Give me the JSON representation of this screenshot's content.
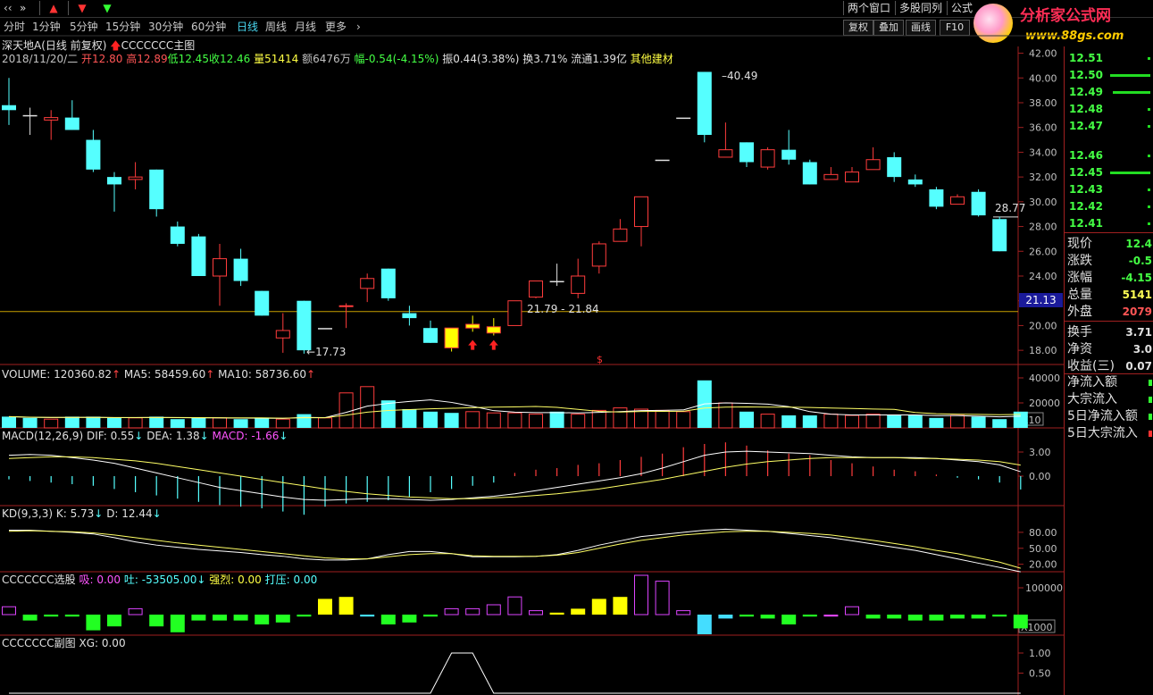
{
  "topbar": {
    "expand_label": "»",
    "windows_label": "两个窗口",
    "multi_label": "多股同列",
    "formula_label": "公式",
    "logo_main": "分析家公式网",
    "logo_url": "www.88gs.com"
  },
  "periods": [
    {
      "label": "分时",
      "active": false
    },
    {
      "label": "1分钟",
      "active": false
    },
    {
      "label": "5分钟",
      "active": false
    },
    {
      "label": "15分钟",
      "active": false
    },
    {
      "label": "30分钟",
      "active": false
    },
    {
      "label": "60分钟",
      "active": false
    },
    {
      "label": "日线",
      "active": true
    },
    {
      "label": "周线",
      "active": false
    },
    {
      "label": "月线",
      "active": false
    },
    {
      "label": "更多",
      "active": false
    }
  ],
  "tools": [
    "复权",
    "叠加",
    "画线",
    "F10"
  ],
  "stock": {
    "name": "深天地A",
    "mode": "(日线 前复权)",
    "indicator": "CCCCCCC主图"
  },
  "quote": {
    "date": "2018/11/20/二",
    "open": "开12.80",
    "high": "高12.89",
    "low": "低12.45",
    "close": "收12.46",
    "volume": "量51414",
    "amount": "额6476万",
    "change": "幅-0.54(-4.15%)",
    "amplitude": "振0.44(3.38%)",
    "turnover": "换3.71%",
    "float": "流通1.39亿",
    "sector": "其他建材"
  },
  "annotations": {
    "high_label": "40.49",
    "low_label": "17.73",
    "range_label": "21.79 - 21.84",
    "last_label": "28.77",
    "cursor_price": "21.13"
  },
  "price_ticks": [
    "42.00",
    "40.00",
    "38.00",
    "36.00",
    "34.00",
    "32.00",
    "30.00",
    "28.00",
    "26.00",
    "24.00",
    "22.00",
    "20.00",
    "18.00"
  ],
  "volume_panel": {
    "title": "VOLUME: 120360.82",
    "ma5": "MA5: 58459.60",
    "ma10": "MA10: 58736.60",
    "ticks": [
      "40000",
      "20000"
    ],
    "unit": "X10"
  },
  "macd_panel": {
    "title": "MACD(12,26,9)",
    "dif": "DIF: 0.55",
    "dea": "DEA: 1.38",
    "macd": "MACD: -1.66",
    "ticks": [
      "3.00",
      "0.00"
    ]
  },
  "kd_panel": {
    "title": "KD(9,3,3)",
    "k": "K: 5.73",
    "d": "D: 12.44",
    "ticks": [
      "80.00",
      "50.00",
      "20.00"
    ]
  },
  "select_panel": {
    "title": "CCCCCCC选股",
    "xi": "吸: 0.00",
    "tu": "吐: -53505.00",
    "qiang": "强烈: 0.00",
    "daya": "打压: 0.00",
    "ticks": [
      "100000"
    ],
    "unit": "X1000"
  },
  "sub_panel": {
    "title": "CCCCCCC副图",
    "xg": "XG: 0.00",
    "ticks": [
      "1.00",
      "0.50"
    ]
  },
  "order_book": [
    {
      "price": "12.51",
      "bar": 0.05
    },
    {
      "price": "12.50",
      "bar": 0.75
    },
    {
      "price": "12.49",
      "bar": 0.7
    },
    {
      "price": "12.48",
      "bar": 0.05
    },
    {
      "price": "12.47",
      "bar": 0.05
    },
    {
      "price": "12.46",
      "bar": 0.05
    },
    {
      "price": "12.45",
      "bar": 0.75
    },
    {
      "price": "12.43",
      "bar": 0.05
    },
    {
      "price": "12.42",
      "bar": 0.05
    },
    {
      "price": "12.41",
      "bar": 0.05
    }
  ],
  "stats": [
    {
      "label": "现价",
      "value": "12.4",
      "color": "#44ff44"
    },
    {
      "label": "涨跌",
      "value": "-0.5",
      "color": "#44ff44"
    },
    {
      "label": "涨幅",
      "value": "-4.15",
      "color": "#44ff44"
    },
    {
      "label": "总量",
      "value": "5141",
      "color": "#ffff55"
    },
    {
      "label": "外盘",
      "value": "2079",
      "color": "#ff5555"
    },
    {
      "label": "换手",
      "value": "3.71",
      "color": "#e0e0e0"
    },
    {
      "label": "净资",
      "value": "3.0",
      "color": "#e0e0e0"
    },
    {
      "label": "收益(三)",
      "value": "0.07",
      "color": "#e0e0e0"
    }
  ],
  "flows": [
    "净流入额",
    "大宗流入",
    "5日净流入额",
    "5日大宗流入"
  ],
  "chart_data": {
    "type": "candlestick",
    "ylim": [
      17,
      42.4
    ],
    "candles": [
      {
        "o": 37.8,
        "h": 40.0,
        "l": 36.2,
        "c": 37.4,
        "dir": "down"
      },
      {
        "o": 37.0,
        "h": 37.6,
        "l": 35.4,
        "c": 36.8,
        "dir": "flat"
      },
      {
        "o": 36.6,
        "h": 37.4,
        "l": 35.0,
        "c": 36.8,
        "dir": "up"
      },
      {
        "o": 36.8,
        "h": 38.2,
        "l": 35.8,
        "c": 35.8,
        "dir": "down"
      },
      {
        "o": 35.0,
        "h": 35.8,
        "l": 32.4,
        "c": 32.6,
        "dir": "down"
      },
      {
        "o": 32.0,
        "h": 32.4,
        "l": 29.2,
        "c": 31.4,
        "dir": "down"
      },
      {
        "o": 31.8,
        "h": 33.2,
        "l": 31.0,
        "c": 32.0,
        "dir": "up"
      },
      {
        "o": 32.6,
        "h": 32.6,
        "l": 28.8,
        "c": 29.4,
        "dir": "down"
      },
      {
        "o": 28.0,
        "h": 28.4,
        "l": 26.4,
        "c": 26.6,
        "dir": "down"
      },
      {
        "o": 27.2,
        "h": 27.4,
        "l": 24.0,
        "c": 24.0,
        "dir": "down"
      },
      {
        "o": 24.0,
        "h": 26.6,
        "l": 21.6,
        "c": 25.4,
        "dir": "up"
      },
      {
        "o": 25.4,
        "h": 26.2,
        "l": 23.2,
        "c": 23.6,
        "dir": "down"
      },
      {
        "o": 22.8,
        "h": 22.8,
        "l": 20.8,
        "c": 20.8,
        "dir": "down"
      },
      {
        "o": 19.0,
        "h": 21.0,
        "l": 17.8,
        "c": 19.6,
        "dir": "up"
      },
      {
        "o": 22.0,
        "h": 22.0,
        "l": 17.73,
        "c": 18.0,
        "dir": "down"
      },
      {
        "o": 19.8,
        "h": 19.8,
        "l": 19.8,
        "c": 19.8,
        "dir": "flat"
      },
      {
        "o": 21.6,
        "h": 21.8,
        "l": 19.8,
        "c": 21.6,
        "dir": "up"
      },
      {
        "o": 23.0,
        "h": 24.2,
        "l": 21.9,
        "c": 23.8,
        "dir": "up"
      },
      {
        "o": 24.6,
        "h": 24.6,
        "l": 22.0,
        "c": 22.2,
        "dir": "down"
      },
      {
        "o": 21.0,
        "h": 21.6,
        "l": 20.0,
        "c": 20.6,
        "dir": "down"
      },
      {
        "o": 19.8,
        "h": 20.4,
        "l": 18.6,
        "c": 18.6,
        "dir": "down"
      },
      {
        "o": 18.2,
        "h": 19.8,
        "l": 17.9,
        "c": 19.8,
        "dir": "yellow"
      },
      {
        "o": 19.8,
        "h": 20.8,
        "l": 19.5,
        "c": 20.1,
        "dir": "yellow"
      },
      {
        "o": 19.4,
        "h": 20.6,
        "l": 19.2,
        "c": 19.9,
        "dir": "yellow"
      },
      {
        "o": 20.0,
        "h": 22.0,
        "l": 20.0,
        "c": 22.0,
        "dir": "up"
      },
      {
        "o": 22.3,
        "h": 23.6,
        "l": 22.2,
        "c": 23.6,
        "dir": "up"
      },
      {
        "o": 23.6,
        "h": 25.0,
        "l": 23.2,
        "c": 23.6,
        "dir": "flat"
      },
      {
        "o": 22.6,
        "h": 25.4,
        "l": 22.2,
        "c": 24.0,
        "dir": "up"
      },
      {
        "o": 24.8,
        "h": 26.8,
        "l": 24.2,
        "c": 26.6,
        "dir": "up"
      },
      {
        "o": 26.8,
        "h": 28.6,
        "l": 26.8,
        "c": 27.8,
        "dir": "up"
      },
      {
        "o": 28.0,
        "h": 30.4,
        "l": 26.4,
        "c": 30.4,
        "dir": "up"
      },
      {
        "o": 33.4,
        "h": 33.4,
        "l": 33.4,
        "c": 33.4,
        "dir": "flat"
      },
      {
        "o": 36.8,
        "h": 36.8,
        "l": 36.8,
        "c": 36.8,
        "dir": "flat"
      },
      {
        "o": 40.49,
        "h": 40.49,
        "l": 34.8,
        "c": 35.4,
        "dir": "down"
      },
      {
        "o": 33.6,
        "h": 36.4,
        "l": 33.6,
        "c": 34.2,
        "dir": "up"
      },
      {
        "o": 34.8,
        "h": 34.8,
        "l": 32.8,
        "c": 33.2,
        "dir": "down"
      },
      {
        "o": 32.8,
        "h": 34.4,
        "l": 32.6,
        "c": 34.2,
        "dir": "up"
      },
      {
        "o": 34.2,
        "h": 35.8,
        "l": 33.0,
        "c": 33.4,
        "dir": "down"
      },
      {
        "o": 33.2,
        "h": 33.4,
        "l": 31.4,
        "c": 31.4,
        "dir": "down"
      },
      {
        "o": 31.8,
        "h": 32.8,
        "l": 31.8,
        "c": 32.2,
        "dir": "up"
      },
      {
        "o": 31.6,
        "h": 32.8,
        "l": 31.6,
        "c": 32.4,
        "dir": "up"
      },
      {
        "o": 32.6,
        "h": 34.4,
        "l": 32.6,
        "c": 33.4,
        "dir": "up"
      },
      {
        "o": 33.6,
        "h": 34.0,
        "l": 31.6,
        "c": 32.0,
        "dir": "down"
      },
      {
        "o": 31.8,
        "h": 32.2,
        "l": 31.2,
        "c": 31.4,
        "dir": "down"
      },
      {
        "o": 31.0,
        "h": 31.2,
        "l": 29.4,
        "c": 29.6,
        "dir": "down"
      },
      {
        "o": 29.8,
        "h": 30.6,
        "l": 29.8,
        "c": 30.4,
        "dir": "up"
      },
      {
        "o": 30.8,
        "h": 31.0,
        "l": 28.8,
        "c": 28.9,
        "dir": "down"
      },
      {
        "o": 28.6,
        "h": 28.8,
        "l": 26.0,
        "c": 26.0,
        "dir": "down"
      }
    ],
    "volume": [
      9,
      8,
      7,
      9,
      9,
      8,
      8,
      9,
      7,
      8,
      8,
      7,
      8,
      7,
      11,
      8,
      28,
      33,
      22,
      15,
      13,
      12,
      13,
      12,
      12,
      11,
      13,
      11,
      14,
      16,
      15,
      14,
      13,
      38,
      20,
      13,
      11,
      10,
      10,
      11,
      10,
      11,
      10,
      10,
      8,
      10,
      9,
      7,
      13
    ],
    "vol_dir": [
      "down",
      "down",
      "up",
      "down",
      "down",
      "down",
      "up",
      "down",
      "down",
      "down",
      "up",
      "down",
      "down",
      "up",
      "down",
      "up",
      "up",
      "up",
      "down",
      "down",
      "down",
      "down",
      "up",
      "up",
      "up",
      "up",
      "down",
      "up",
      "up",
      "up",
      "up",
      "up",
      "up",
      "down",
      "up",
      "down",
      "up",
      "down",
      "down",
      "up",
      "up",
      "up",
      "down",
      "down",
      "down",
      "up",
      "down",
      "down",
      "down"
    ],
    "vol_ma5": [
      9,
      8.5,
      8.3,
      8.4,
      8.5,
      8.2,
      8.2,
      8.4,
      8.2,
      8.0,
      8.0,
      7.9,
      7.8,
      7.6,
      8.4,
      8.2,
      12.4,
      17.4,
      19.6,
      21.2,
      22.4,
      20.4,
      17.2,
      13.8,
      12.6,
      12.2,
      12.2,
      12.0,
      12.4,
      13.0,
      13.8,
      14.0,
      14.4,
      19.2,
      20.0,
      19.6,
      19.0,
      17.0,
      13.0,
      11.0,
      10.4,
      10.4,
      10.4,
      10.4,
      9.8,
      9.8,
      9.4,
      8.8,
      9.4
    ],
    "vol_ma10": [
      9,
      8.6,
      8.4,
      8.4,
      8.4,
      8.3,
      8.3,
      8.3,
      8.3,
      8.2,
      8.1,
      8.0,
      8.0,
      7.8,
      8.1,
      8.1,
      10.2,
      12.6,
      13.9,
      14.6,
      15.3,
      15.7,
      16.2,
      16.6,
      16.8,
      17.1,
      16.4,
      14.8,
      13.2,
      12.7,
      13.1,
      13.2,
      13.3,
      15.9,
      16.6,
      16.8,
      16.6,
      16.6,
      16.3,
      15.9,
      15.5,
      15.1,
      14.8,
      12.3,
      11.3,
      11.0,
      10.8,
      10.5,
      10.8
    ],
    "macd_hist": [
      -0.4,
      -0.6,
      -0.8,
      -1.0,
      -1.2,
      -1.6,
      -2.0,
      -2.4,
      -2.8,
      -3.2,
      -3.6,
      -3.8,
      -4.0,
      -4.4,
      -4.8,
      -3.8,
      -3.4,
      -3.2,
      -3.0,
      -2.6,
      -2.0,
      -1.6,
      -1.2,
      -0.8,
      0.4,
      0.8,
      1.0,
      1.4,
      1.6,
      2.0,
      2.4,
      2.8,
      3.6,
      4.0,
      4.2,
      3.8,
      3.2,
      2.8,
      2.6,
      2.0,
      1.6,
      1.2,
      0.8,
      0.6,
      0.2,
      -0.2,
      -0.4,
      -0.8,
      -1.66
    ],
    "macd_dif": [
      2.6,
      2.7,
      2.6,
      2.3,
      2.0,
      1.6,
      1.0,
      0.4,
      -0.2,
      -0.8,
      -1.4,
      -1.8,
      -2.2,
      -2.6,
      -2.9,
      -3.0,
      -2.9,
      -2.8,
      -2.8,
      -2.9,
      -3.0,
      -2.9,
      -2.7,
      -2.5,
      -2.2,
      -1.8,
      -1.4,
      -1.0,
      -0.6,
      -0.2,
      0.3,
      1.0,
      1.8,
      2.6,
      3.0,
      3.1,
      3.0,
      2.9,
      2.8,
      2.6,
      2.4,
      2.3,
      2.3,
      2.3,
      2.2,
      2.0,
      1.8,
      1.4,
      0.55
    ],
    "macd_dea": [
      2.2,
      2.3,
      2.4,
      2.4,
      2.3,
      2.1,
      1.9,
      1.6,
      1.2,
      0.8,
      0.4,
      0.0,
      -0.4,
      -0.8,
      -1.2,
      -1.6,
      -1.9,
      -2.2,
      -2.4,
      -2.6,
      -2.7,
      -2.8,
      -2.8,
      -2.7,
      -2.6,
      -2.4,
      -2.2,
      -1.9,
      -1.6,
      -1.2,
      -0.8,
      -0.4,
      0.1,
      0.6,
      1.1,
      1.5,
      1.8,
      2.0,
      2.2,
      2.3,
      2.3,
      2.3,
      2.3,
      2.2,
      2.2,
      2.1,
      2.0,
      1.8,
      1.38
    ],
    "kd_k": [
      84,
      84,
      82,
      80,
      77,
      70,
      62,
      56,
      52,
      48,
      45,
      42,
      38,
      35,
      30,
      28,
      28,
      30,
      38,
      44,
      44,
      40,
      34,
      34,
      34,
      35,
      38,
      46,
      56,
      64,
      72,
      76,
      80,
      84,
      86,
      84,
      82,
      78,
      74,
      70,
      64,
      58,
      52,
      46,
      38,
      30,
      22,
      14,
      5.73
    ],
    "kd_d": [
      82,
      83,
      82,
      81,
      79,
      75,
      70,
      65,
      60,
      56,
      52,
      48,
      44,
      40,
      36,
      32,
      30,
      30,
      34,
      38,
      40,
      40,
      36,
      35,
      35,
      35,
      37,
      42,
      50,
      58,
      65,
      70,
      75,
      78,
      81,
      82,
      82,
      80,
      78,
      75,
      70,
      65,
      59,
      53,
      46,
      40,
      32,
      24,
      12.44
    ],
    "select_hist": [
      4,
      -3,
      -1,
      -1,
      -8,
      -6,
      3,
      -6,
      -9,
      -3,
      -3,
      -3,
      -5,
      -4,
      -1,
      8,
      9,
      -1,
      -5,
      -4,
      -1,
      3,
      3,
      5,
      9,
      2,
      1,
      3,
      8,
      9,
      20,
      17,
      2,
      -10,
      -2,
      -1,
      -2,
      -5,
      -1,
      -1,
      4,
      -2,
      -2,
      -3,
      -3,
      -2,
      -2,
      -1,
      -7
    ],
    "select_color": [
      "mag",
      "grn",
      "grn",
      "grn",
      "grn",
      "grn",
      "mag",
      "grn",
      "grn",
      "grn",
      "grn",
      "grn",
      "grn",
      "grn",
      "grn",
      "yel",
      "yel",
      "cyn",
      "grn",
      "grn",
      "grn",
      "mag",
      "mag",
      "mag",
      "mag",
      "mag",
      "yel",
      "yel",
      "yel",
      "yel",
      "mag",
      "mag",
      "mag",
      "cyn",
      "cyn",
      "grn",
      "grn",
      "grn",
      "grn",
      "mag",
      "mag",
      "grn",
      "grn",
      "grn",
      "grn",
      "grn",
      "grn",
      "grn",
      "grn"
    ],
    "xg_signal": [
      0,
      0,
      0,
      0,
      0,
      0,
      0,
      0,
      0,
      0,
      0,
      0,
      0,
      0,
      0,
      0,
      0,
      0,
      0,
      0,
      0,
      1,
      1,
      0,
      0,
      0,
      0,
      0,
      0,
      0,
      0,
      0,
      0,
      0,
      0,
      0,
      0,
      0,
      0,
      0,
      0,
      0,
      0,
      0,
      0,
      0,
      0,
      0,
      0
    ]
  },
  "colors": {
    "up": "#ff3c3c",
    "down": "#55ffff",
    "yellow": "#ffff00",
    "grid": "#7a1010",
    "axis": "#a02020"
  }
}
